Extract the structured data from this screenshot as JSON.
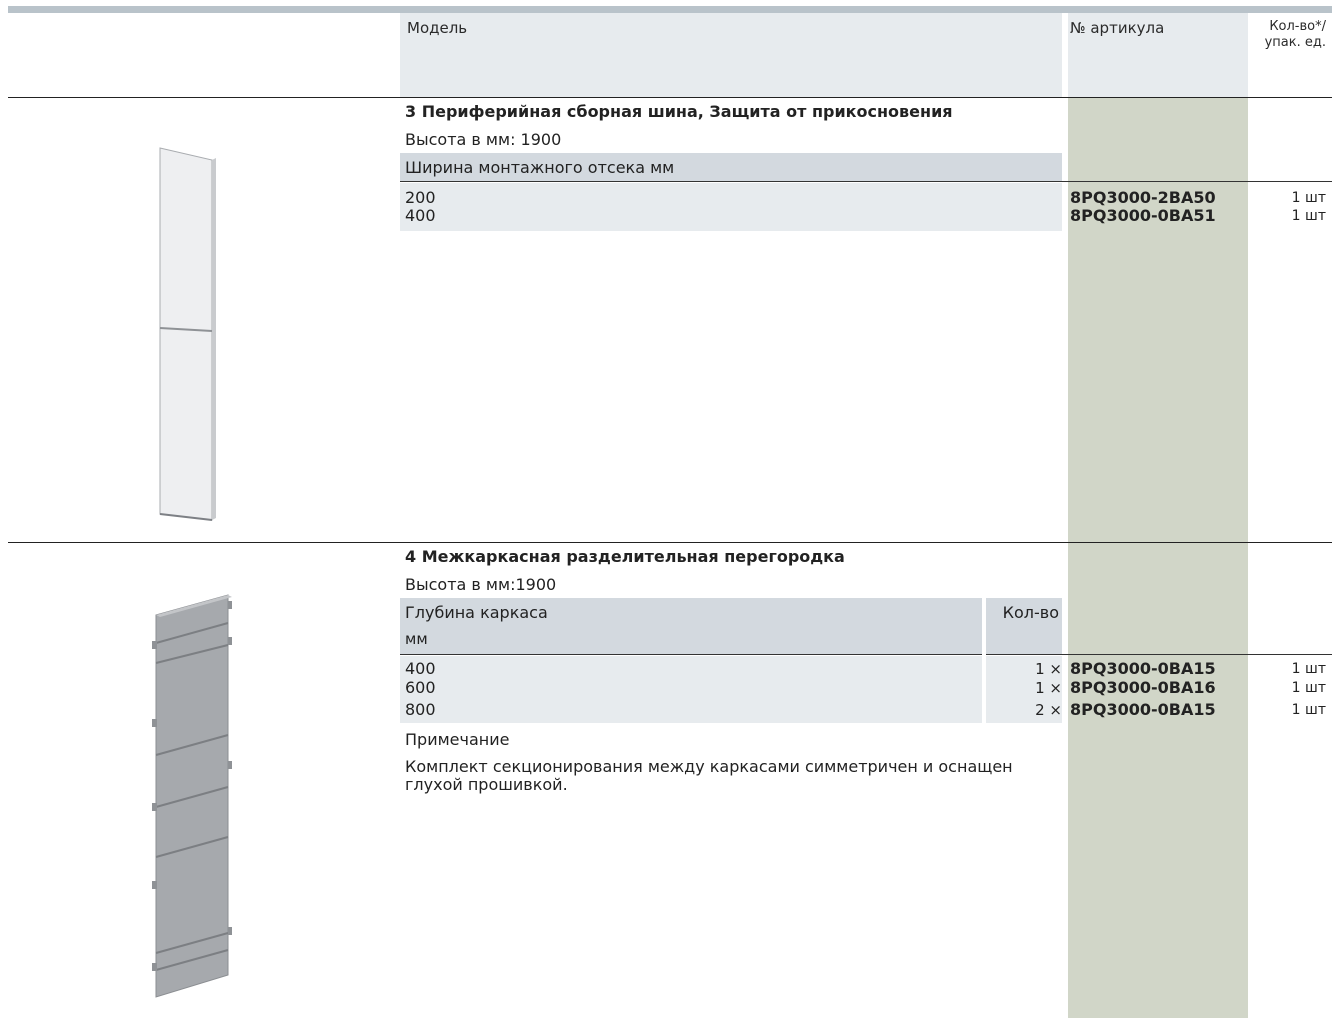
{
  "header": {
    "model": "Модель",
    "article": "№ артикула",
    "qty_line1": "Кол-во*/",
    "qty_line2": "упак. ед."
  },
  "section3": {
    "title": "3 Периферийная сборная шина, Защита от прикосновения",
    "height": "Высота в мм: 1900",
    "col_header": "Ширина монтажного отсека мм",
    "rows": [
      {
        "value": "200",
        "article": "8PQ3000-2BA50",
        "qty": "1 шт"
      },
      {
        "value": "400",
        "article": "8PQ3000-0BA51",
        "qty": "1 шт"
      }
    ]
  },
  "section4": {
    "title": "4 Межкаркасная разделительная перегородка",
    "height": "Высота в мм:1900",
    "col_header_1": "Глубина каркаса",
    "col_header_1b": "мм",
    "col_header_2": "Кол-во",
    "rows": [
      {
        "value": "400",
        "count": "1 ×",
        "article": "8PQ3000-0BA15",
        "qty": "1 шт"
      },
      {
        "value": "600",
        "count": "1 ×",
        "article": "8PQ3000-0BA16",
        "qty": "1 шт"
      },
      {
        "value": "800",
        "count": "2 ×",
        "article": "8PQ3000-0BA15",
        "qty": "1 шт"
      }
    ],
    "note_label": "Примечание",
    "note_text": "Комплект секционирования между каркасами симметричен и оснащен глухой прошивкой."
  },
  "colors": {
    "green_column": "#d1d6c8",
    "header_band": "#d3d9df",
    "light_band": "#e7ebee"
  },
  "images": [
    "touch-protection-panel-image",
    "partition-panel-image"
  ]
}
